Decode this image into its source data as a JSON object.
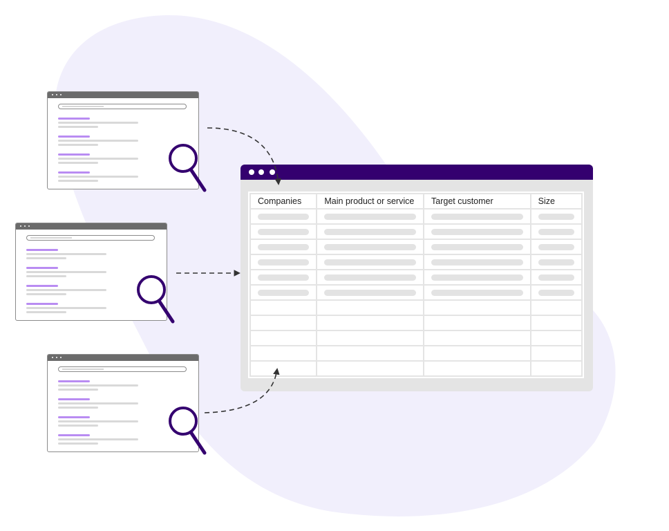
{
  "colors": {
    "background_blob": "#f1effc",
    "accent_purple": "#34006f",
    "result_title_purple": "#b98cf2",
    "mini_window_bar": "#6b6b6b",
    "placeholder_gray": "#e3e3e3",
    "arrow": "#333333"
  },
  "search_windows": [
    {
      "name": "search-window-top",
      "icon": "magnifier-icon",
      "results": 4
    },
    {
      "name": "search-window-middle",
      "icon": "magnifier-icon",
      "results": 4
    },
    {
      "name": "search-window-bottom",
      "icon": "magnifier-icon",
      "results": 4
    }
  ],
  "table_window": {
    "columns": [
      "Companies",
      "Main product or service",
      "Target customer",
      "Size"
    ],
    "filled_rows": 6,
    "empty_rows": 5
  }
}
